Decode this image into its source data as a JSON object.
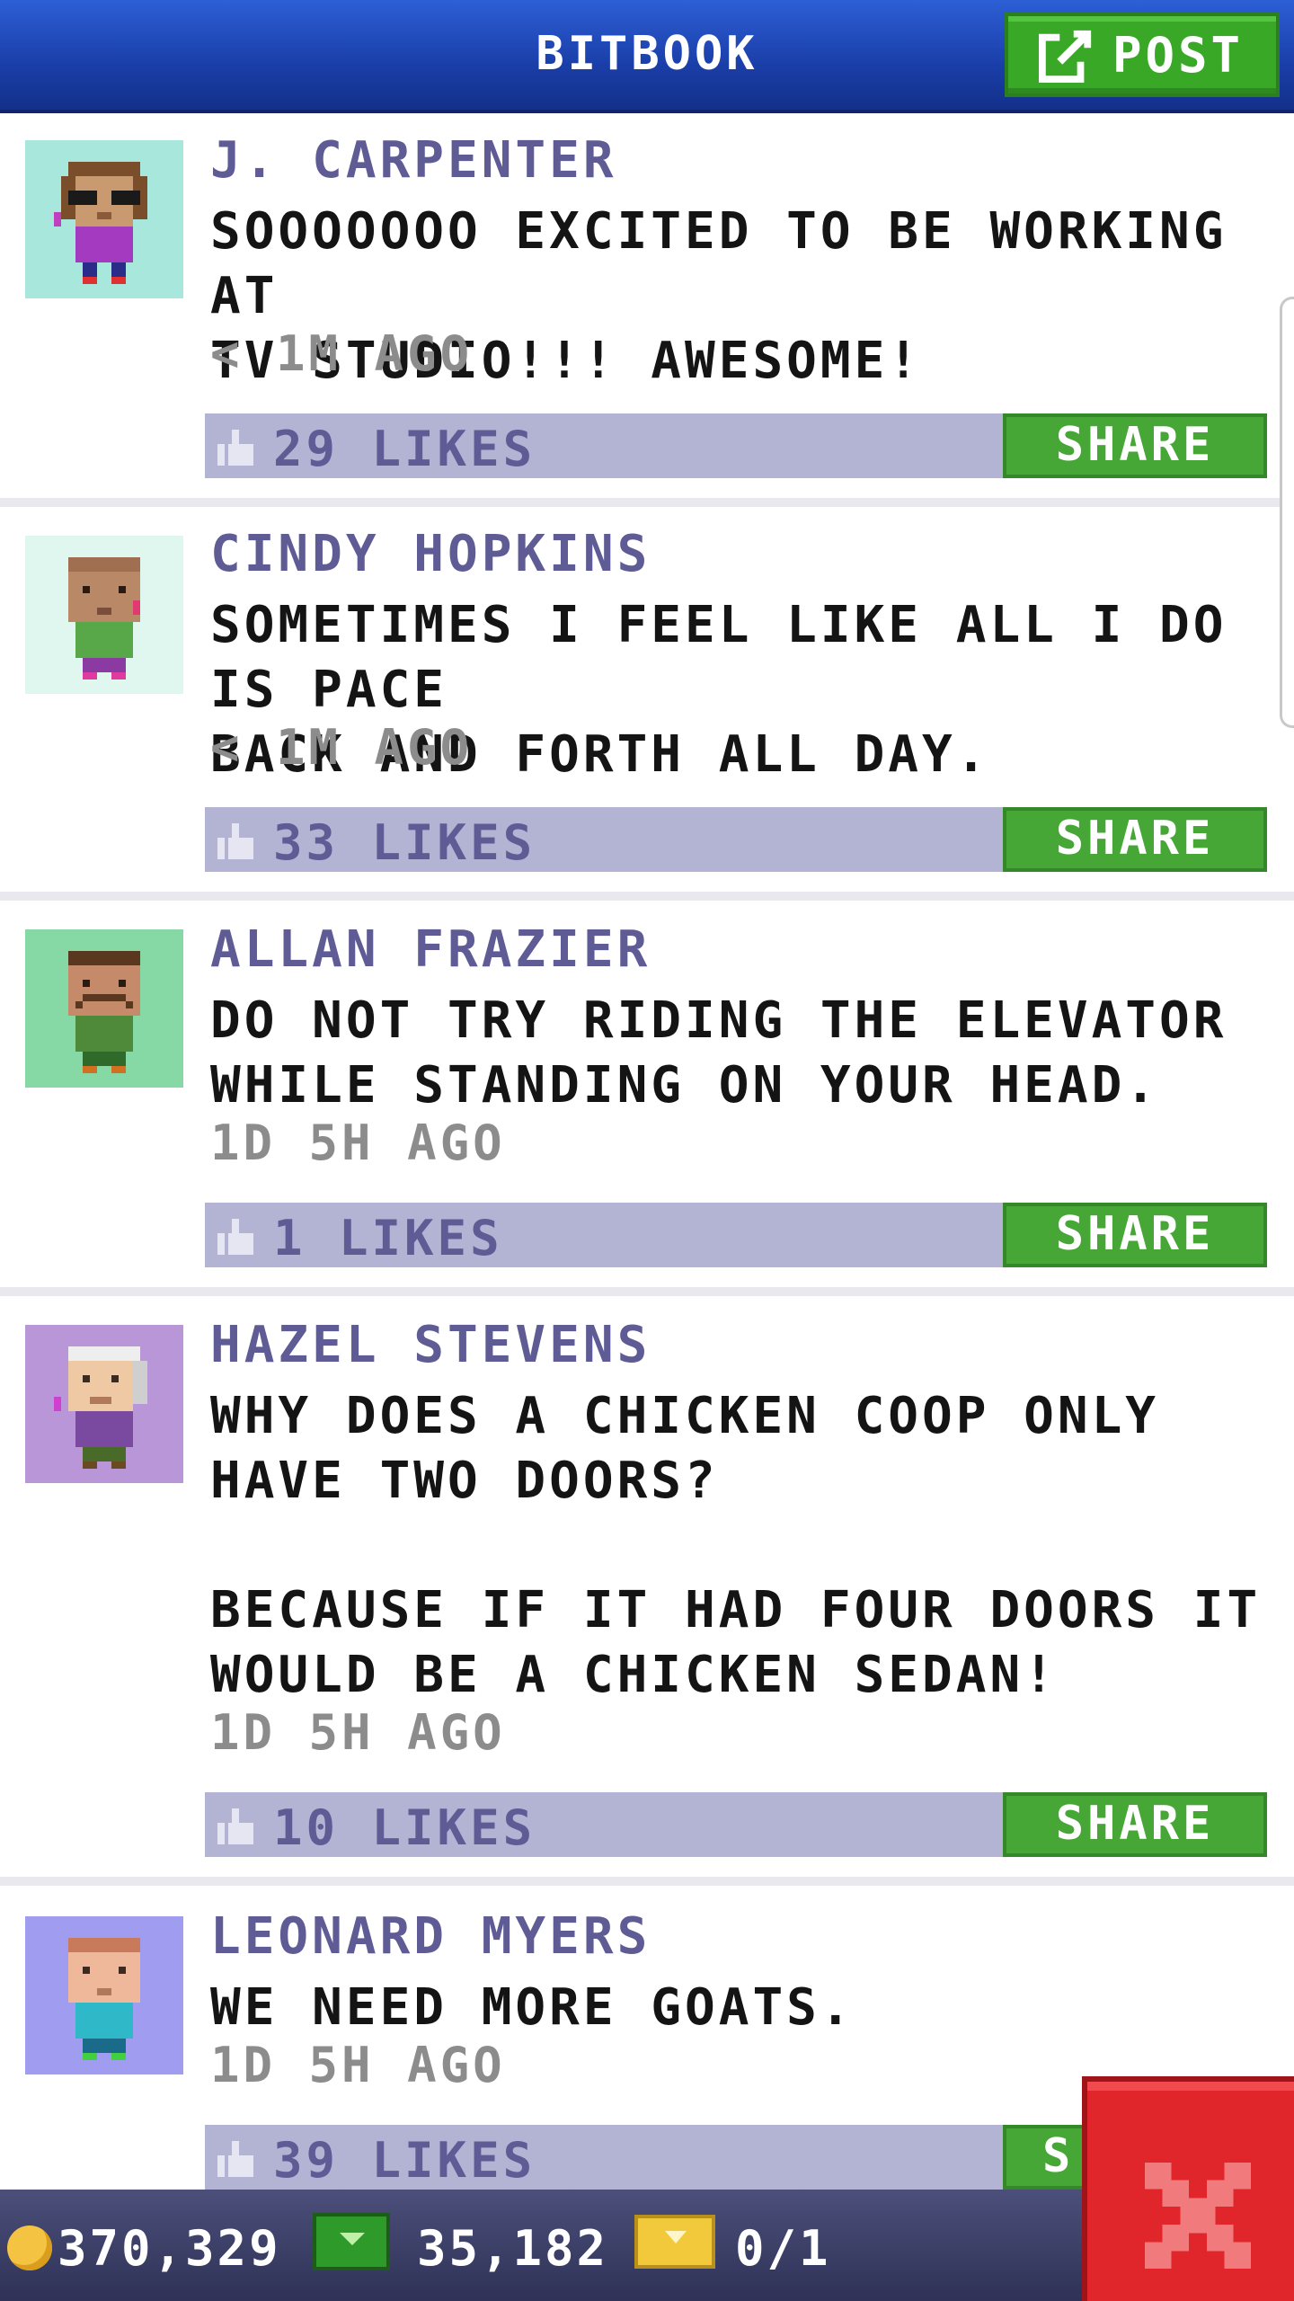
{
  "header": {
    "title": "BITBOOK",
    "post_label": "POST"
  },
  "posts": [
    {
      "author": "J. CARPENTER",
      "message": "SOOOOOOO EXCITED TO BE WORKING AT\nTV STUDIO!!! AWESOME!",
      "time": "< 1M AGO",
      "likes": "29 LIKES",
      "share": "SHARE"
    },
    {
      "author": "CINDY HOPKINS",
      "message": "SOMETIMES I FEEL LIKE ALL I DO IS PACE\nBACK AND FORTH ALL DAY.",
      "time": "< 1M AGO",
      "likes": "33 LIKES",
      "share": "SHARE"
    },
    {
      "author": "ALLAN FRAZIER",
      "message": "DO NOT TRY RIDING THE ELEVATOR\nWHILE STANDING ON YOUR HEAD.",
      "time": "1D 5H AGO",
      "likes": "1 LIKES",
      "share": "SHARE"
    },
    {
      "author": "HAZEL STEVENS",
      "message": "WHY DOES A CHICKEN COOP ONLY\nHAVE TWO DOORS?\n\nBECAUSE IF IT HAD FOUR DOORS IT\nWOULD BE A CHICKEN SEDAN!",
      "time": "1D 5H AGO",
      "likes": "10 LIKES",
      "share": "SHARE"
    },
    {
      "author": "LEONARD MYERS",
      "message": "WE NEED MORE GOATS.",
      "time": "1D 5H AGO",
      "likes": "39 LIKES",
      "share": "S"
    }
  ],
  "footer": {
    "coins": "370,329",
    "bux": "35,182",
    "tickets": "0/1"
  },
  "colors": {
    "header_blue": "#1a3ea8",
    "post_green": "#3aa827",
    "author_purple": "#5f5b95",
    "likes_bar": "#b3b3d4",
    "close_red": "#e0262b"
  },
  "icons": {
    "post": "edit-icon",
    "like": "thumbs-up-icon",
    "coin": "coin-icon",
    "bux": "bux-icon",
    "ticket": "ticket-icon",
    "close": "close-icon"
  }
}
